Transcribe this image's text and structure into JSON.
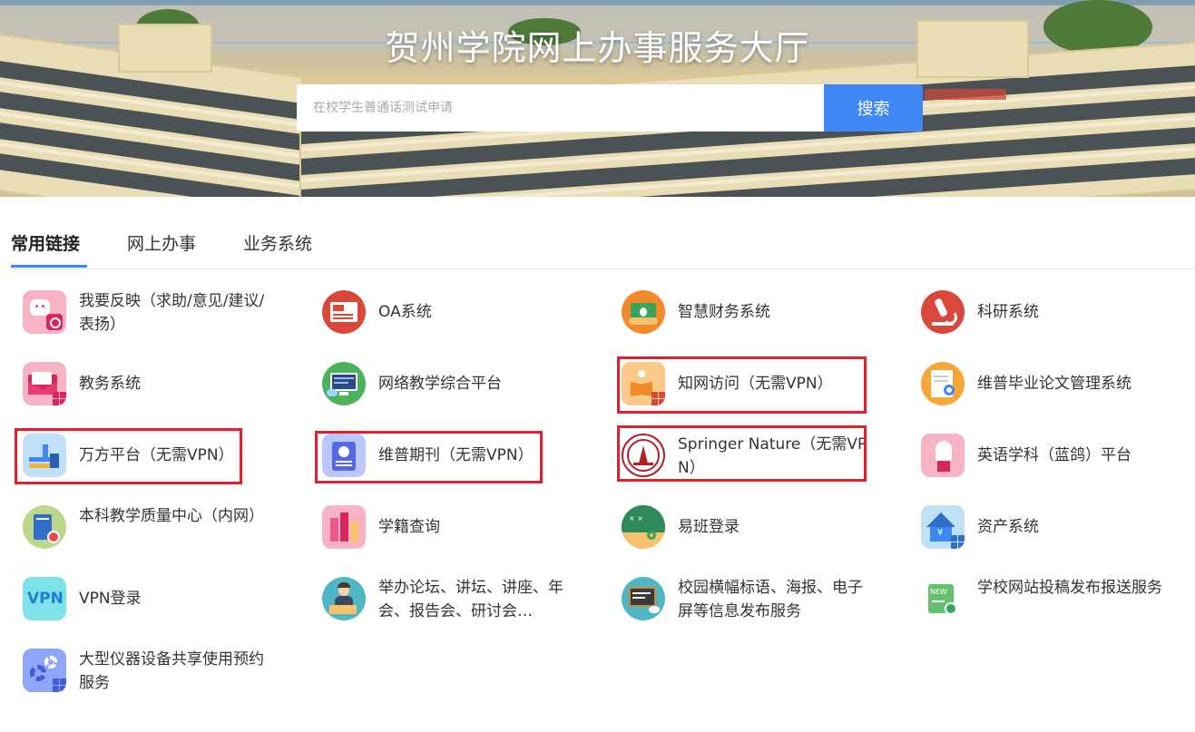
{
  "hero": {
    "title": "贺州学院网上办事服务大厅",
    "search_placeholder": "在校学生普通话测试申请",
    "search_button": "搜索"
  },
  "tabs": [
    {
      "label": "常用链接",
      "active": true
    },
    {
      "label": "网上办事",
      "active": false
    },
    {
      "label": "业务系统",
      "active": false
    }
  ],
  "accent_color": "#3f87f5",
  "highlight_color": "#e0202a",
  "links": [
    {
      "label": "我要反映（求助/意见/建议/表扬）",
      "icon": "feedback-icon",
      "highlighted": false
    },
    {
      "label": "OA系统",
      "icon": "oa-icon",
      "highlighted": false
    },
    {
      "label": "智慧财务系统",
      "icon": "finance-icon",
      "highlighted": false
    },
    {
      "label": "科研系统",
      "icon": "microscope-icon",
      "highlighted": false
    },
    {
      "label": "教务系统",
      "icon": "envelope-icon",
      "highlighted": false
    },
    {
      "label": "网络教学综合平台",
      "icon": "monitor-icon",
      "highlighted": false
    },
    {
      "label": "知网访问（无需VPN）",
      "icon": "book-reader-icon",
      "highlighted": true
    },
    {
      "label": "维普毕业论文管理系统",
      "icon": "thesis-search-icon",
      "highlighted": false
    },
    {
      "label": "万方平台（无需VPN）",
      "icon": "wanfang-icon",
      "highlighted": true
    },
    {
      "label": "维普期刊（无需VPN）",
      "icon": "journal-icon",
      "highlighted": true
    },
    {
      "label": "Springer Nature（无需VPN）",
      "icon": "university-seal-icon",
      "highlighted": true
    },
    {
      "label": "英语学科（蓝鸽）平台",
      "icon": "raised-hand-icon",
      "highlighted": false
    },
    {
      "label": "本科教学质量中心（内网）",
      "icon": "quality-book-icon",
      "highlighted": false
    },
    {
      "label": "学籍查询",
      "icon": "student-record-icon",
      "highlighted": false
    },
    {
      "label": "易班登录",
      "icon": "blackboard-icon",
      "highlighted": false
    },
    {
      "label": "资产系统",
      "icon": "asset-house-icon",
      "highlighted": false
    },
    {
      "label": "VPN登录",
      "icon": "vpn-icon",
      "highlighted": false
    },
    {
      "label": "举办论坛、讲坛、讲座、年会、报告会、研讨会…",
      "icon": "lecture-icon",
      "highlighted": false
    },
    {
      "label": "校园横幅标语、海报、电子屏等信息发布服务",
      "icon": "screen-eye-icon",
      "highlighted": false
    },
    {
      "label": "学校网站投稿发布报送服务",
      "icon": "new-upload-icon",
      "highlighted": false
    },
    {
      "label": "大型仪器设备共享使用预约服务",
      "icon": "gears-icon",
      "highlighted": false
    }
  ]
}
